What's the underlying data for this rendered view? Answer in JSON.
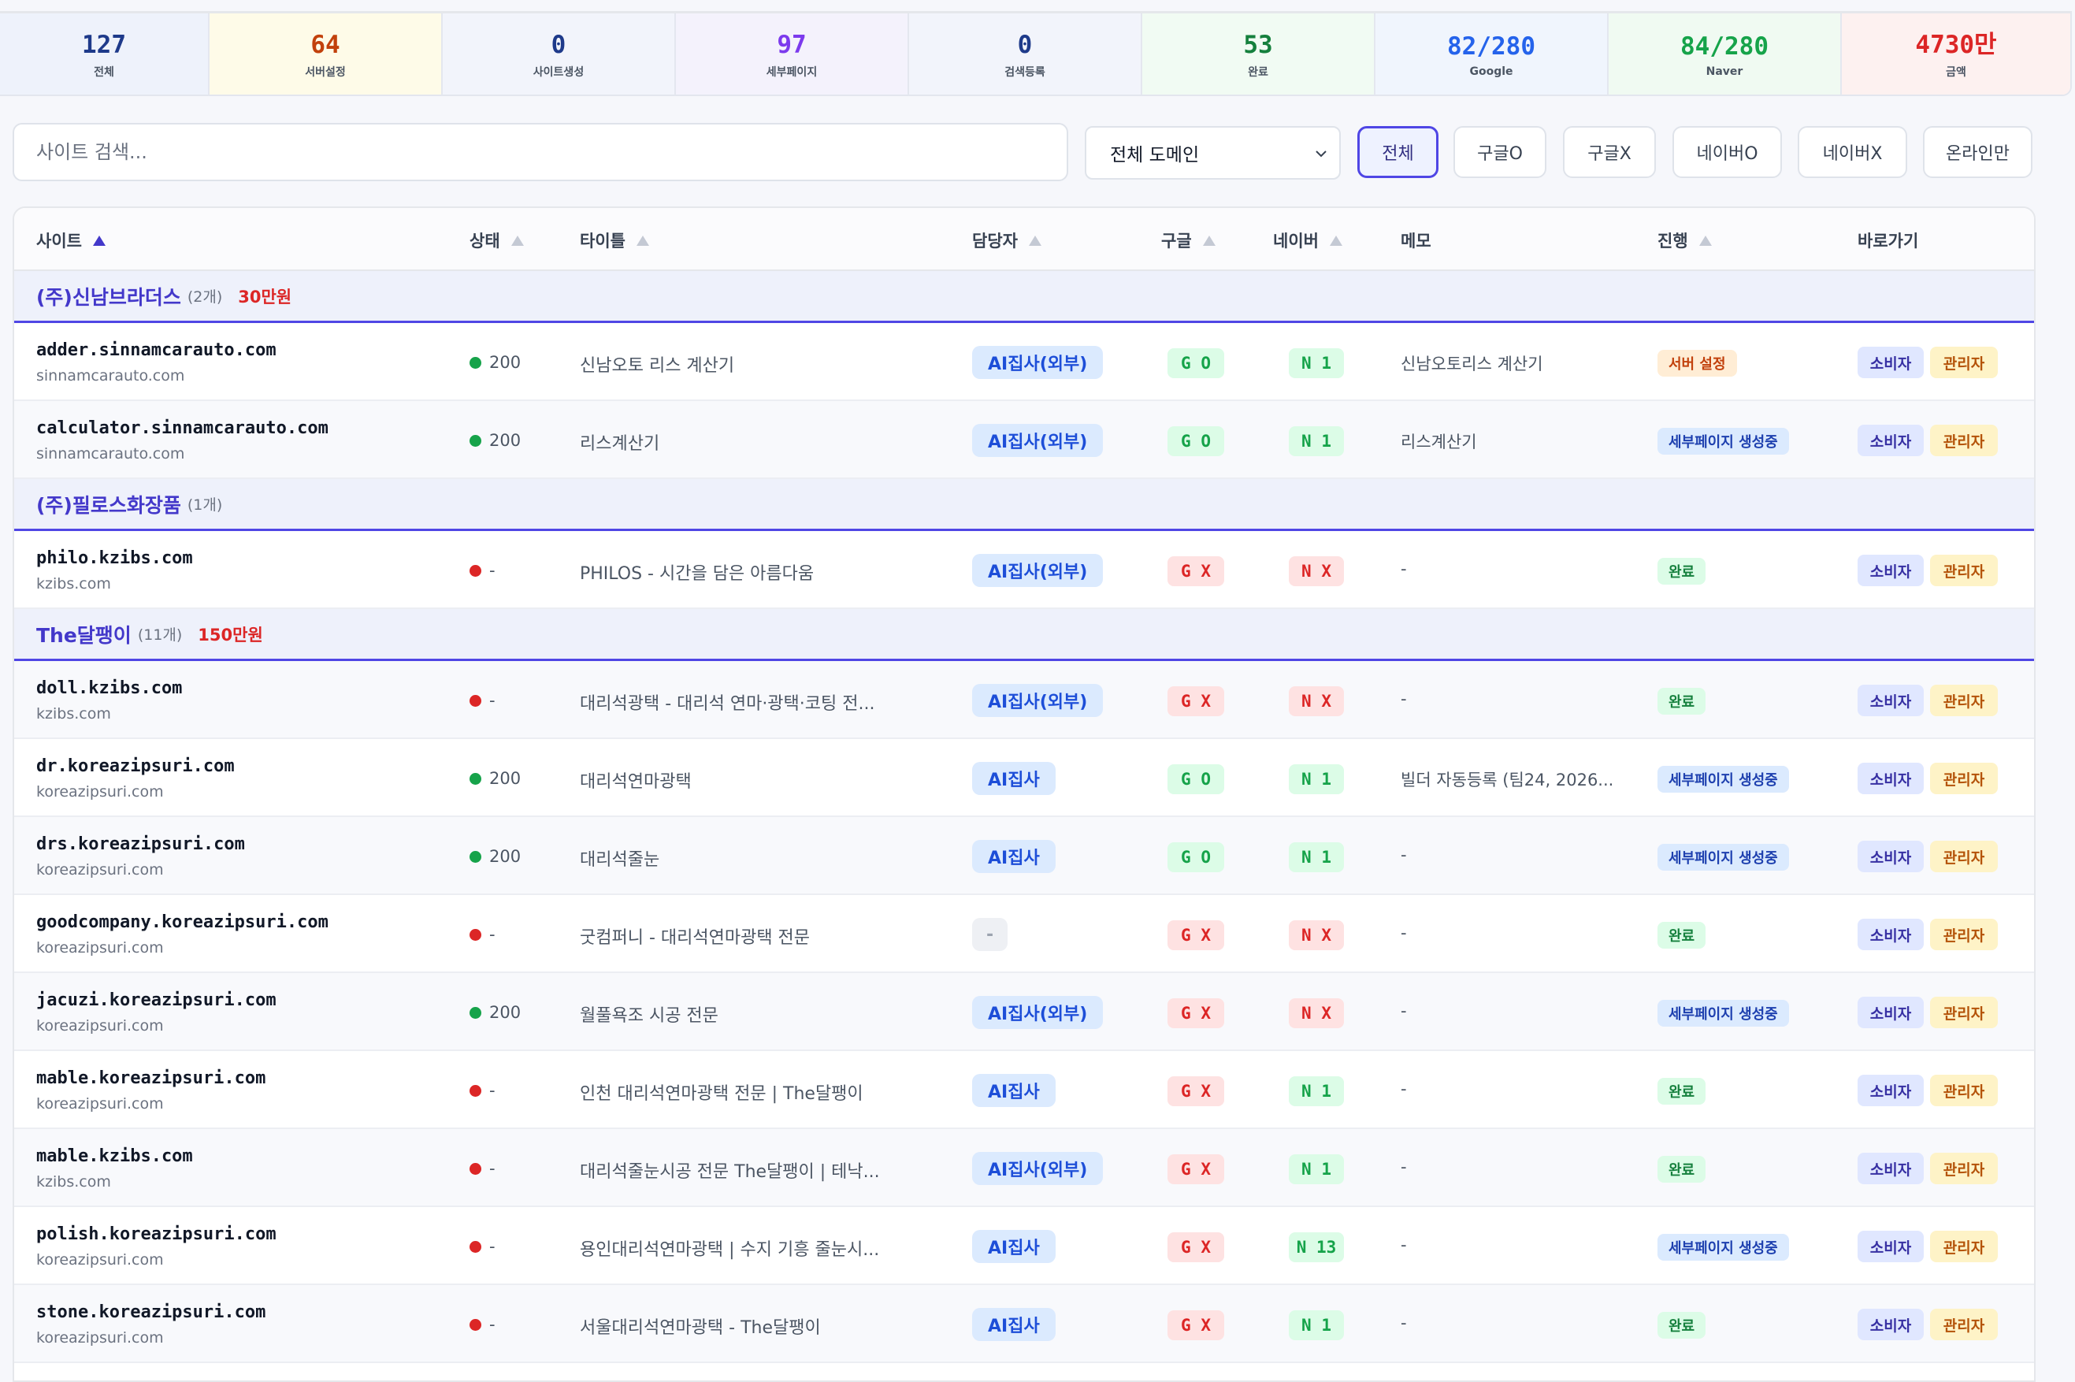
{
  "stats": [
    {
      "value": "127",
      "label": "전체",
      "color": "#1e3a8a",
      "bg": "#eef2fb"
    },
    {
      "value": "64",
      "label": "서버설정",
      "color": "#c2410c",
      "bg": "#fefbe8"
    },
    {
      "value": "0",
      "label": "사이트생성",
      "color": "#1e3a8a",
      "bg": "#f2f4fb"
    },
    {
      "value": "97",
      "label": "세부페이지",
      "color": "#7c3aed",
      "bg": "#f4f2fc"
    },
    {
      "value": "0",
      "label": "검색등록",
      "color": "#1e3a8a",
      "bg": "#f2f4fb"
    },
    {
      "value": "53",
      "label": "완료",
      "color": "#15803d",
      "bg": "#f1fbf3"
    },
    {
      "value": "82/280",
      "label": "Google",
      "color": "#2563eb",
      "bg": "#f0f5fd"
    },
    {
      "value": "84/280",
      "label": "Naver",
      "color": "#16a34a",
      "bg": "#f0faf2"
    },
    {
      "value": "4730만",
      "label": "금액",
      "color": "#dc2626",
      "bg": "#fdf1f0"
    }
  ],
  "search": {
    "placeholder": "사이트 검색..."
  },
  "domain_select": {
    "value": "전체 도메인"
  },
  "filters": [
    "전체",
    "구글O",
    "구글X",
    "네이버O",
    "네이버X",
    "온라인만"
  ],
  "columns": {
    "site": "사이트",
    "status": "상태",
    "title": "타이틀",
    "manager": "담당자",
    "google": "구글",
    "naver": "네이버",
    "memo": "메모",
    "progress": "진행",
    "links": "바로가기"
  },
  "buttons": {
    "consumer": "소비자",
    "admin": "관리자"
  },
  "groups": [
    {
      "name": "(주)신남브라더스",
      "count": "(2개)",
      "amount": "30만원",
      "rows": [
        {
          "site": "adder.sinnamcarauto.com",
          "domain": "sinnamcarauto.com",
          "status": "ok",
          "code": "200",
          "title": "신남오토 리스 계산기",
          "manager": "AI집사(외부)",
          "google": "G O",
          "gok": true,
          "naver": "N 1",
          "nok": true,
          "memo": "신남오토리스 계산기",
          "progress": "서버 설정",
          "ptype": "server"
        },
        {
          "site": "calculator.sinnamcarauto.com",
          "domain": "sinnamcarauto.com",
          "status": "ok",
          "code": "200",
          "title": "리스계산기",
          "manager": "AI집사(외부)",
          "google": "G O",
          "gok": true,
          "naver": "N 1",
          "nok": true,
          "memo": "리스계산기",
          "progress": "세부페이지 생성중",
          "ptype": "detail"
        }
      ]
    },
    {
      "name": "(주)필로스화장품",
      "count": "(1개)",
      "amount": "",
      "rows": [
        {
          "site": "philo.kzibs.com",
          "domain": "kzibs.com",
          "status": "err",
          "code": "-",
          "title": "PHILOS - 시간을 담은 아름다움",
          "manager": "AI집사(외부)",
          "google": "G X",
          "gok": false,
          "naver": "N X",
          "nok": false,
          "memo": "-",
          "progress": "완료",
          "ptype": "done"
        }
      ]
    },
    {
      "name": "The달팽이",
      "count": "(11개)",
      "amount": "150만원",
      "rows": [
        {
          "site": "doll.kzibs.com",
          "domain": "kzibs.com",
          "status": "err",
          "code": "-",
          "title": "대리석광택 - 대리석 연마·광택·코팅 전...",
          "manager": "AI집사(외부)",
          "google": "G X",
          "gok": false,
          "naver": "N X",
          "nok": false,
          "memo": "-",
          "progress": "완료",
          "ptype": "done"
        },
        {
          "site": "dr.koreazipsuri.com",
          "domain": "koreazipsuri.com",
          "status": "ok",
          "code": "200",
          "title": "대리석연마광택",
          "manager": "AI집사",
          "google": "G O",
          "gok": true,
          "naver": "N 1",
          "nok": true,
          "memo": "빌더 자동등록 (팀24, 2026...",
          "progress": "세부페이지 생성중",
          "ptype": "detail"
        },
        {
          "site": "drs.koreazipsuri.com",
          "domain": "koreazipsuri.com",
          "status": "ok",
          "code": "200",
          "title": "대리석줄눈",
          "manager": "AI집사",
          "google": "G O",
          "gok": true,
          "naver": "N 1",
          "nok": true,
          "memo": "-",
          "progress": "세부페이지 생성중",
          "ptype": "detail"
        },
        {
          "site": "goodcompany.koreazipsuri.com",
          "domain": "koreazipsuri.com",
          "status": "err",
          "code": "-",
          "title": "굿컴퍼니 - 대리석연마광택 전문",
          "manager": "-",
          "google": "G X",
          "gok": false,
          "naver": "N X",
          "nok": false,
          "memo": "-",
          "progress": "완료",
          "ptype": "done"
        },
        {
          "site": "jacuzi.koreazipsuri.com",
          "domain": "koreazipsuri.com",
          "status": "ok",
          "code": "200",
          "title": "월풀욕조 시공 전문",
          "manager": "AI집사(외부)",
          "google": "G X",
          "gok": false,
          "naver": "N X",
          "nok": false,
          "memo": "-",
          "progress": "세부페이지 생성중",
          "ptype": "detail"
        },
        {
          "site": "mable.koreazipsuri.com",
          "domain": "koreazipsuri.com",
          "status": "err",
          "code": "-",
          "title": "인천 대리석연마광택 전문 | The달팽이",
          "manager": "AI집사",
          "google": "G X",
          "gok": false,
          "naver": "N 1",
          "nok": true,
          "memo": "-",
          "progress": "완료",
          "ptype": "done"
        },
        {
          "site": "mable.kzibs.com",
          "domain": "kzibs.com",
          "status": "err",
          "code": "-",
          "title": "대리석줄눈시공 전문 The달팽이 | 테낙...",
          "manager": "AI집사(외부)",
          "google": "G X",
          "gok": false,
          "naver": "N 1",
          "nok": true,
          "memo": "-",
          "progress": "완료",
          "ptype": "done"
        },
        {
          "site": "polish.koreazipsuri.com",
          "domain": "koreazipsuri.com",
          "status": "err",
          "code": "-",
          "title": "용인대리석연마광택 | 수지 기흥 줄눈시...",
          "manager": "AI집사",
          "google": "G X",
          "gok": false,
          "naver": "N 13",
          "nok": true,
          "memo": "-",
          "progress": "세부페이지 생성중",
          "ptype": "detail"
        },
        {
          "site": "stone.koreazipsuri.com",
          "domain": "koreazipsuri.com",
          "status": "err",
          "code": "-",
          "title": "서울대리석연마광택 - The달팽이",
          "manager": "AI집사",
          "google": "G X",
          "gok": false,
          "naver": "N 1",
          "nok": true,
          "memo": "-",
          "progress": "완료",
          "ptype": "done"
        }
      ]
    }
  ]
}
